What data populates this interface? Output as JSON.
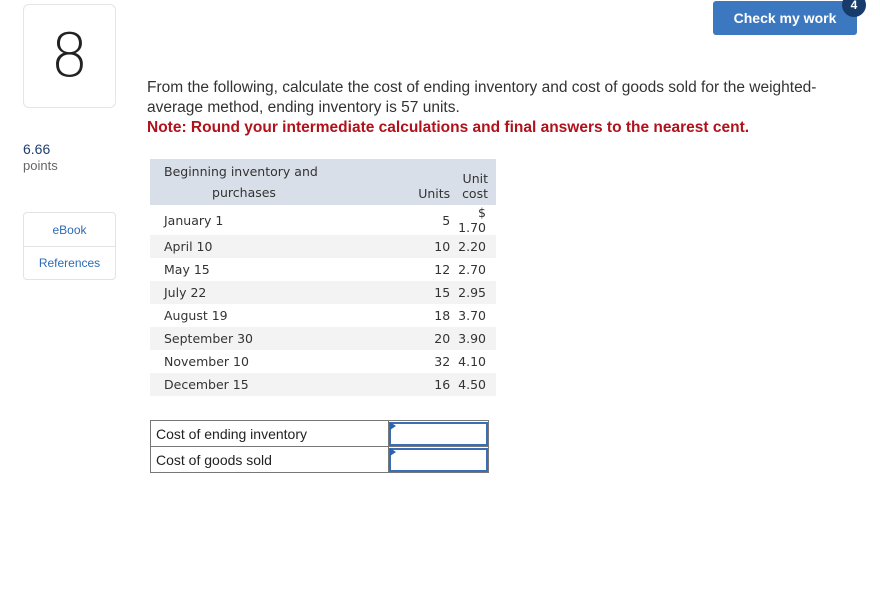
{
  "question": {
    "number": "8",
    "points_value": "6.66",
    "points_label": "points",
    "text": "From the following, calculate the cost of ending inventory and cost of goods sold for the weighted-average method, ending inventory is 57 units.",
    "note": "Note: Round your intermediate calculations and final answers to the nearest cent."
  },
  "sidebar": {
    "links": [
      {
        "label": "eBook"
      },
      {
        "label": "References"
      }
    ]
  },
  "header": {
    "check_button_label": "Check my work",
    "check_badge_count": "4"
  },
  "inventory_table": {
    "headers": {
      "col1_line1": "Beginning inventory and",
      "col1_line2": "purchases",
      "col2": "Units",
      "col3": "Unit cost"
    },
    "rows": [
      {
        "date": "January 1",
        "units": "5",
        "unit_cost": "$ 1.70"
      },
      {
        "date": "April 10",
        "units": "10",
        "unit_cost": "2.20"
      },
      {
        "date": "May 15",
        "units": "12",
        "unit_cost": "2.70"
      },
      {
        "date": "July 22",
        "units": "15",
        "unit_cost": "2.95"
      },
      {
        "date": "August 19",
        "units": "18",
        "unit_cost": "3.70"
      },
      {
        "date": "September 30",
        "units": "20",
        "unit_cost": "3.90"
      },
      {
        "date": "November 10",
        "units": "32",
        "unit_cost": "4.10"
      },
      {
        "date": "December 15",
        "units": "16",
        "unit_cost": "4.50"
      }
    ]
  },
  "answers": {
    "rows": [
      {
        "label": "Cost of ending inventory",
        "value": ""
      },
      {
        "label": "Cost of goods sold",
        "value": ""
      }
    ]
  },
  "colors": {
    "accent": "#3b78c0",
    "badge": "#173b6a",
    "note": "#b0121b",
    "table_header": "#d9dfe8"
  }
}
